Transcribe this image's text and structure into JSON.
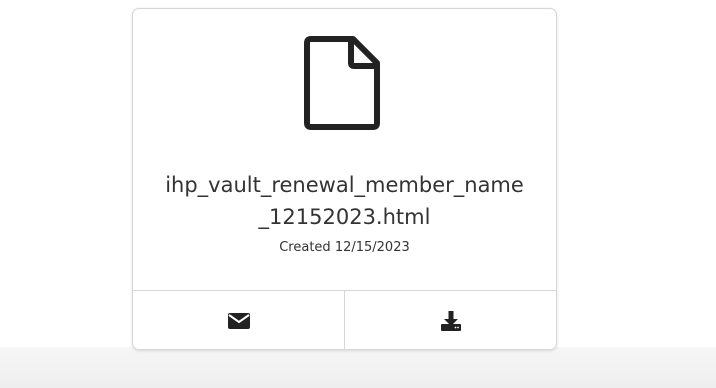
{
  "file": {
    "name_line1": "ihp_vault_renewal_member_name",
    "name_line2": "_12152023.html",
    "created": "Created 12/15/2023",
    "icon": "document-icon"
  },
  "actions": [
    {
      "icon": "envelope-icon"
    },
    {
      "icon": "download-icon"
    }
  ],
  "colors": {
    "text": "#333333",
    "icon": "#222222",
    "border": "#d6d6d6"
  }
}
